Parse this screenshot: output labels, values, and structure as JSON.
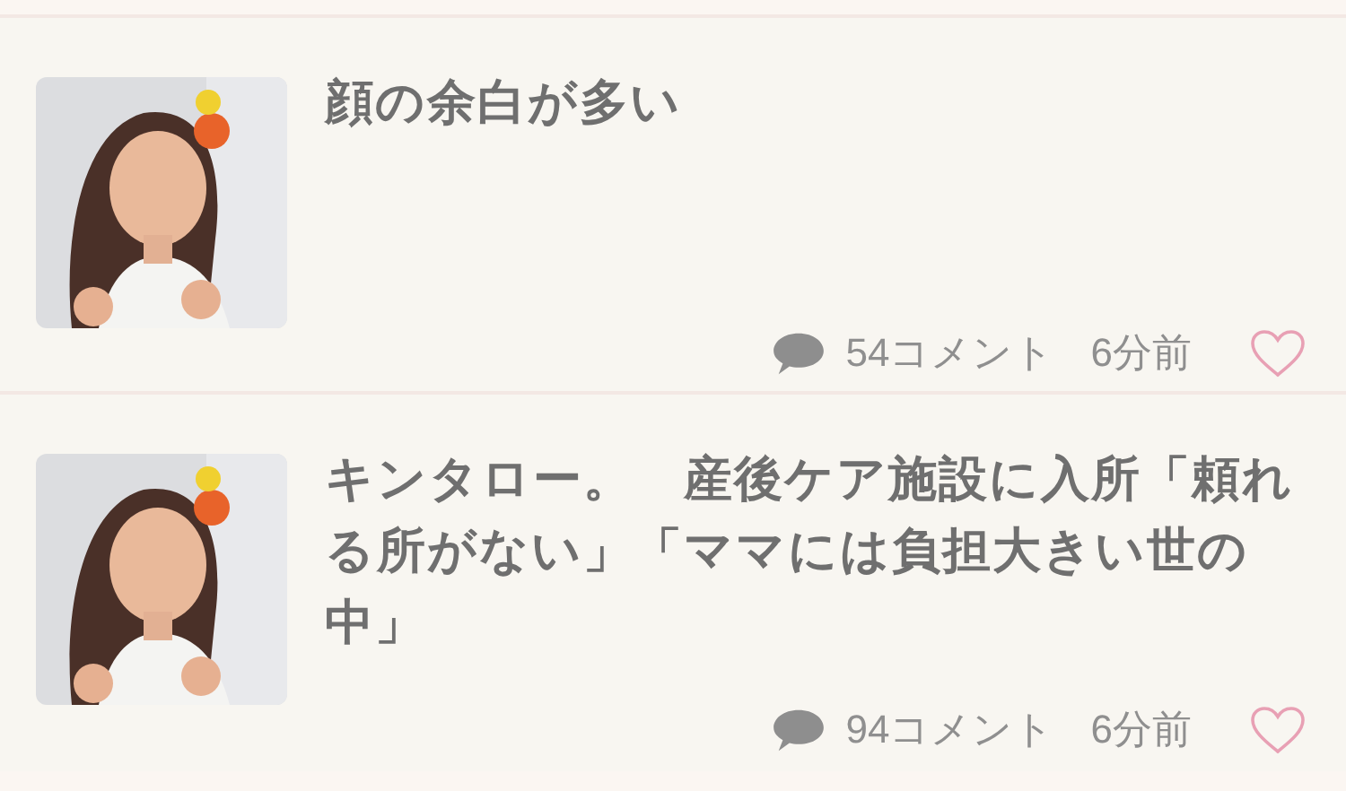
{
  "articles": [
    {
      "title": "顔の余白が多い",
      "comments": "54コメント",
      "time": "6分前",
      "liked": false
    },
    {
      "title": "キンタロー。　産後ケア施設に入所「頼れる所がない」「ママには負担大きい世の中」",
      "comments": "94コメント",
      "time": "6分前",
      "liked": false
    }
  ]
}
